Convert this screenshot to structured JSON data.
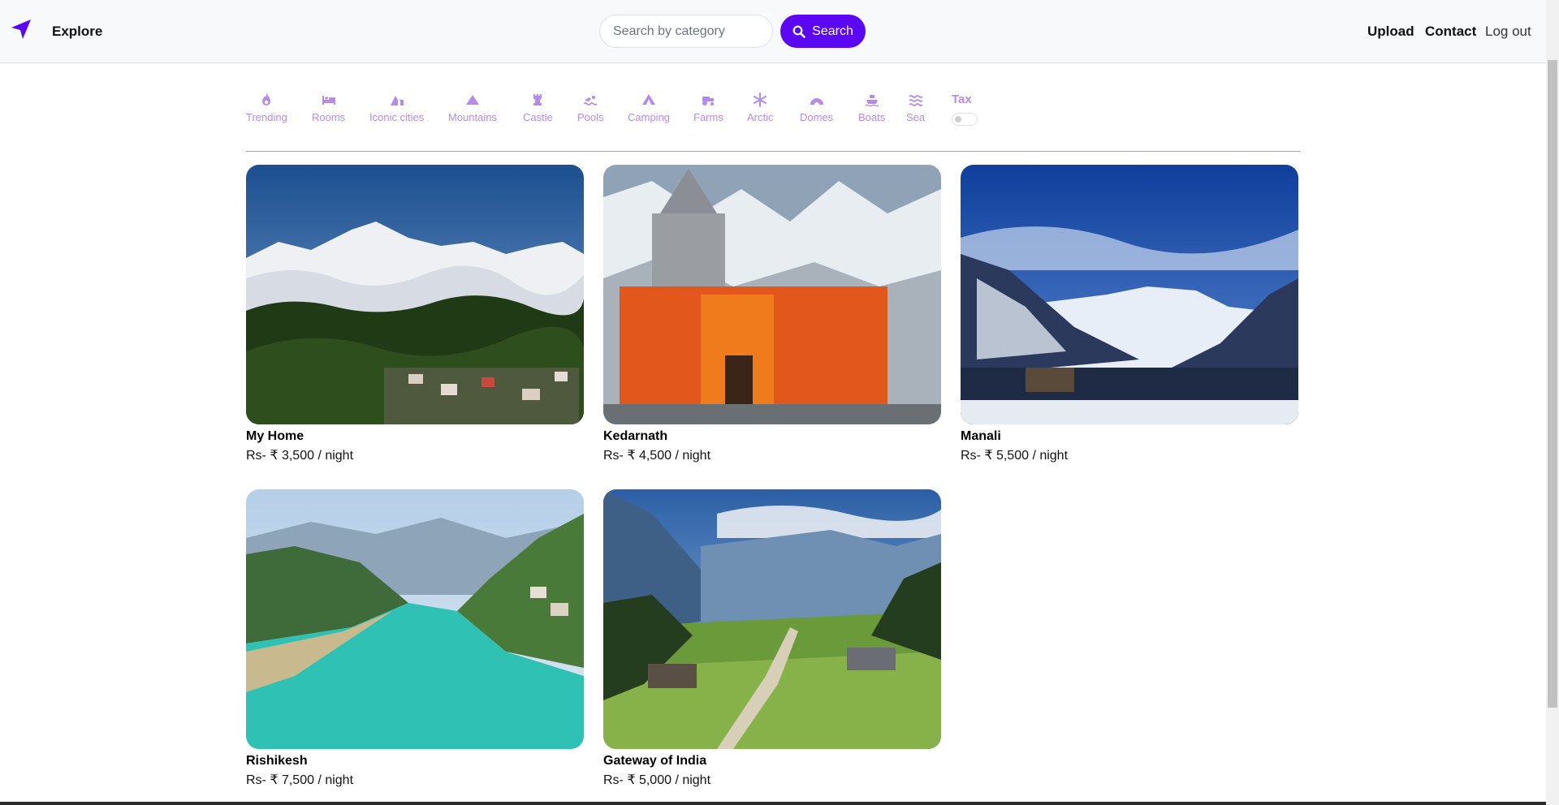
{
  "navbar": {
    "brand": "Explore",
    "search_placeholder": "Search by category",
    "search_button": "Search",
    "links": {
      "upload": "Upload",
      "contact": "Contact",
      "logout": "Log out"
    }
  },
  "colors": {
    "accent": "#5b07f4",
    "filter_text": "#b58be8"
  },
  "filters": [
    {
      "label": "Trending",
      "icon": "fire-icon"
    },
    {
      "label": "Rooms",
      "icon": "bed-icon"
    },
    {
      "label": "Iconic cities",
      "icon": "mountain-city-icon"
    },
    {
      "label": "Mountains",
      "icon": "mountain-icon"
    },
    {
      "label": "Castle",
      "icon": "castle-icon"
    },
    {
      "label": "Pools",
      "icon": "swimmer-icon"
    },
    {
      "label": "Camping",
      "icon": "tent-icon"
    },
    {
      "label": "Farms",
      "icon": "tractor-icon"
    },
    {
      "label": "Arctic",
      "icon": "snowflake-icon"
    },
    {
      "label": "Domes",
      "icon": "igloo-icon"
    },
    {
      "label": "Boats",
      "icon": "ship-icon"
    },
    {
      "label": "Sea",
      "icon": "water-icon"
    }
  ],
  "tax": {
    "label": "Tax",
    "toggle_on": false
  },
  "listings": [
    {
      "title": "My Home",
      "price": "Rs- ₹ 3,500 / night"
    },
    {
      "title": "Kedarnath",
      "price": "Rs- ₹ 4,500 / night"
    },
    {
      "title": "Manali",
      "price": "Rs- ₹ 5,500 / night"
    },
    {
      "title": "Rishikesh",
      "price": "Rs- ₹ 7,500 / night"
    },
    {
      "title": "Gateway of India",
      "price": "Rs- ₹ 5,000 / night"
    }
  ]
}
